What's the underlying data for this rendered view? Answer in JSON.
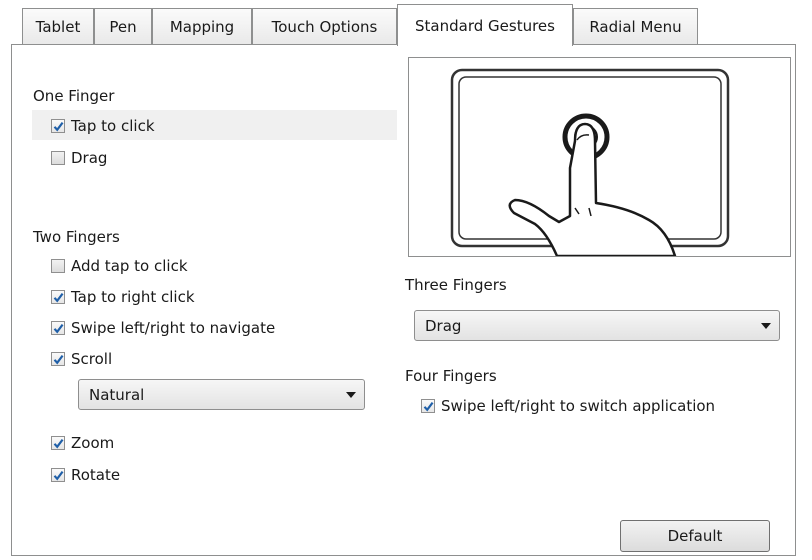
{
  "tabs": [
    "Tablet",
    "Pen",
    "Mapping",
    "Touch Options",
    "Standard Gestures",
    "Radial Menu"
  ],
  "active_tab": "Standard Gestures",
  "one_finger": {
    "label": "One Finger",
    "tap_to_click": {
      "label": "Tap to click",
      "checked": true
    },
    "drag": {
      "label": "Drag",
      "checked": false
    }
  },
  "two_fingers": {
    "label": "Two Fingers",
    "add_tap_to_click": {
      "label": "Add tap to click",
      "checked": false
    },
    "tap_to_right_click": {
      "label": "Tap to right click",
      "checked": true
    },
    "swipe_navigate": {
      "label": "Swipe left/right to navigate",
      "checked": true
    },
    "scroll": {
      "label": "Scroll",
      "checked": true
    },
    "scroll_mode": "Natural",
    "zoom": {
      "label": "Zoom",
      "checked": true
    },
    "rotate": {
      "label": "Rotate",
      "checked": true
    }
  },
  "three_fingers": {
    "label": "Three Fingers",
    "selected": "Drag"
  },
  "four_fingers": {
    "label": "Four Fingers",
    "swipe_switch": {
      "label": "Swipe left/right to switch application",
      "checked": true
    }
  },
  "default_button": "Default",
  "colors": {
    "border": "#8e8f8f",
    "check": "#1f5fa8",
    "row_highlight": "#f0f0f0"
  }
}
